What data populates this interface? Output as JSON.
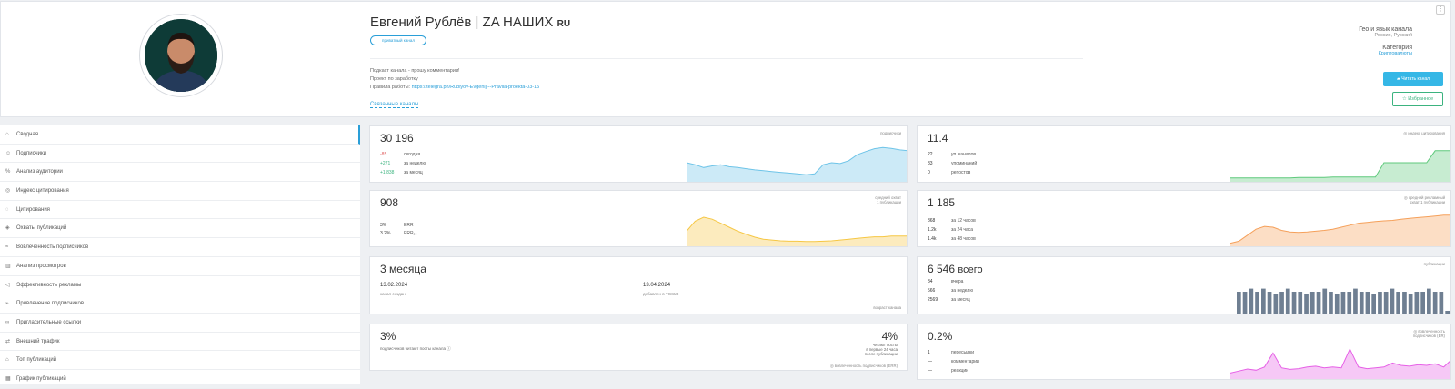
{
  "header": {
    "title": "Евгений Рублёв | ZA НАШИХ",
    "lang": "RU",
    "badge": "приватный канал",
    "desc_lines": [
      "Подкаст канала - прошу комментарии!",
      "Проект по заработку"
    ],
    "rules_label": "Правила работы:",
    "rules_link": "https://telegra.ph/Rublyov-Evgenij---Pravila-proekta-03-15",
    "linked_channels": "Связанные каналы",
    "geo_label": "Гео и язык канала",
    "geo_value": "Россия, Русский",
    "category_label": "Категория",
    "category_value": "Криптовалюты",
    "read_button": "Читать канал",
    "fav_button": "Избранное",
    "menu": "⋮"
  },
  "sidebar": {
    "items": [
      {
        "label": "Сводная",
        "icon": "home-icon",
        "glyph": "⌂"
      },
      {
        "label": "Подписчики",
        "icon": "users-icon",
        "glyph": "☺"
      },
      {
        "label": "Анализ аудитории",
        "icon": "percent-icon",
        "glyph": "%"
      },
      {
        "label": "Индекс цитирования",
        "icon": "citation-icon",
        "glyph": "◎"
      },
      {
        "label": "Цитирования",
        "icon": "search-icon",
        "glyph": "◌"
      },
      {
        "label": "Охваты публикаций",
        "icon": "reach-icon",
        "glyph": "◈"
      },
      {
        "label": "Вовлеченность подписчиков",
        "icon": "wifi-icon",
        "glyph": "≈"
      },
      {
        "label": "Анализ просмотров",
        "icon": "bar-chart-icon",
        "glyph": "▥"
      },
      {
        "label": "Эффективность рекламы",
        "icon": "megaphone-icon",
        "glyph": "◁"
      },
      {
        "label": "Привлечение подписчиков",
        "icon": "trend-icon",
        "glyph": "⌁"
      },
      {
        "label": "Пригласительные ссылки",
        "icon": "link-icon",
        "glyph": "∞"
      },
      {
        "label": "Внешний трафик",
        "icon": "arrows-icon",
        "glyph": "⇄"
      },
      {
        "label": "Топ публикаций",
        "icon": "top-icon",
        "glyph": "⌂"
      },
      {
        "label": "График публикаций",
        "icon": "calendar-icon",
        "glyph": "▦"
      }
    ]
  },
  "subs": {
    "value": "30 196",
    "caption": "подписчики",
    "rows": [
      {
        "n": "-85",
        "t": "сегодня",
        "c": "neg"
      },
      {
        "n": "+271",
        "t": "за неделю",
        "c": "pos"
      },
      {
        "n": "+1 838",
        "t": "за месяц",
        "c": "pos"
      }
    ],
    "color": "#6ec4e8"
  },
  "cit": {
    "value": "11.4",
    "caption": "индекс цитирования",
    "rows": [
      {
        "n": "22",
        "t": "уп. каналов"
      },
      {
        "n": "83",
        "t": "упоминаний"
      },
      {
        "n": "0",
        "t": "репостов"
      }
    ],
    "color": "#5fc97c"
  },
  "reach": {
    "value": "908",
    "caption1": "средний охват",
    "caption2": "1 публикации",
    "rows": [
      {
        "n": "3%",
        "t": "ERR"
      },
      {
        "n": "3.2%",
        "t": "ERR₂₄"
      }
    ],
    "color": "#f6c744"
  },
  "ad": {
    "value": "1 185",
    "caption1": "средний рекламный",
    "caption2": "охват 1 публикации",
    "rows": [
      {
        "n": "868",
        "t": "за 12 часов"
      },
      {
        "n": "1.2k",
        "t": "за 24 часа"
      },
      {
        "n": "1.4k",
        "t": "за 48 часов"
      }
    ],
    "color": "#f5a05a"
  },
  "age": {
    "value": "3 месяца",
    "caption": "возраст канала",
    "created_date": "13.02.2024",
    "created_label": "канал создан",
    "added_date": "13.04.2024",
    "added_label": "добавлен в TGStat"
  },
  "posts": {
    "value": "6 546",
    "unit": "всего",
    "caption": "публикации",
    "rows": [
      {
        "n": "84",
        "t": "вчера"
      },
      {
        "n": "566",
        "t": "за неделю"
      },
      {
        "n": "2569",
        "t": "за месяц"
      }
    ],
    "color": "#6f7f92"
  },
  "engage": {
    "value": "3%",
    "label": "подписчиков читают посты канала",
    "value2": "4%",
    "sub1": "читают посты",
    "sub2": "в первые 24 часа",
    "sub3": "после публикации",
    "caption": "вовлеченность подписчиков (ERR)"
  },
  "er": {
    "value": "0.2%",
    "caption1": "вовлеченность",
    "caption2": "подписчиков (ER)",
    "rows": [
      {
        "n": "1",
        "t": "пересылки"
      },
      {
        "n": "—",
        "t": "комментарии"
      },
      {
        "n": "—",
        "t": "реакции"
      }
    ],
    "color": "#e660e6"
  }
}
